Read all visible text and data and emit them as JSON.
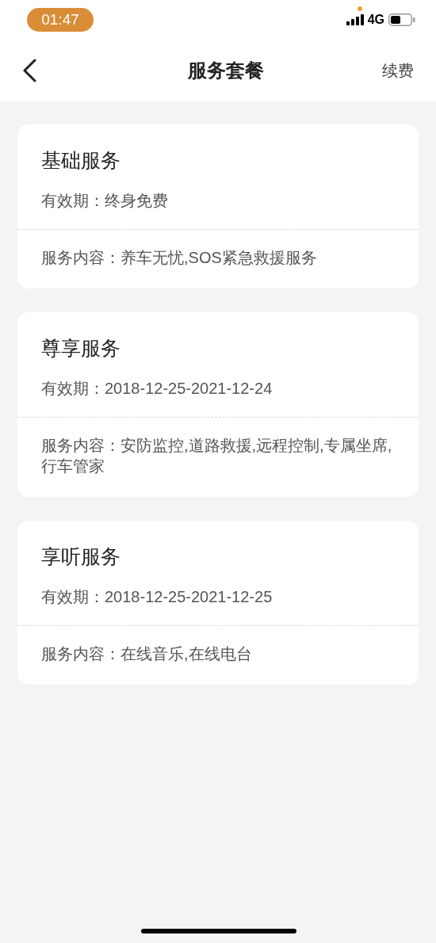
{
  "status_bar": {
    "time": "01:47",
    "network": "4G"
  },
  "header": {
    "title": "服务套餐",
    "action": "续费"
  },
  "cards": [
    {
      "title": "基础服务",
      "validity": "有效期：终身免费",
      "content": "服务内容：养车无忧,SOS紧急救援服务"
    },
    {
      "title": "尊享服务",
      "validity": "有效期：2018-12-25-2021-12-24",
      "content": "服务内容：安防监控,道路救援,远程控制,专属坐席,行车管家"
    },
    {
      "title": "享听服务",
      "validity": "有效期：2018-12-25-2021-12-25",
      "content": "服务内容：在线音乐,在线电台"
    }
  ]
}
